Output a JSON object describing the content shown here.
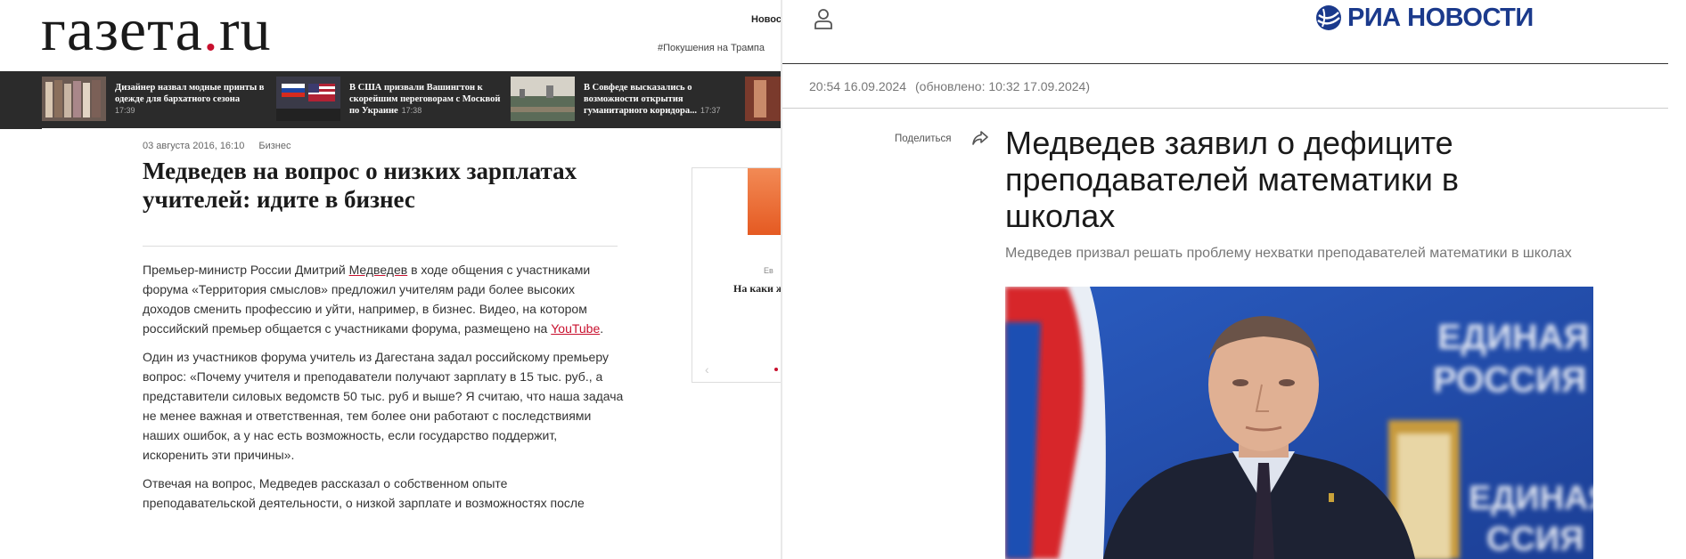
{
  "gazeta": {
    "logo": {
      "main": "газета",
      "dot": ".",
      "tld": "ru"
    },
    "nav_news": "Новос",
    "tag": "#Покушения на Трампа",
    "strip": [
      {
        "title": "Дизайнер назвал модные принты в одежде для бархатного сезона",
        "time": "17:39"
      },
      {
        "title": "В США призвали Вашингтон к скорейшим переговорам с Москвой по Украине",
        "time": "17:38"
      },
      {
        "title": "В Совфеде высказались о возможности открытия гуманитарного коридора...",
        "time": "17:37"
      }
    ],
    "article": {
      "date": "03 августа 2016, 16:10",
      "rubric": "Бизнес",
      "title": "Медведев на вопрос о низких зарплатах учителей: идите в бизнес",
      "p1_a": "Премьер-министр России Дмитрий ",
      "p1_link": "Медведев",
      "p1_b": " в ходе общения с участниками форума «Территория смыслов» предложил учителям ради более высоких доходов сменить профессию и уйти, например, в бизнес. Видео, на котором российский премьер общается с участниками форума, размещено на ",
      "p1_yt": "YouTube",
      "p1_end": ".",
      "p2": "Один из участников форума учитель из Дагестана задал российскому премьеру вопрос: «Почему учителя и преподаватели получают зарплату в 15 тыс. руб., а представители силовых ведомств 50 тыс. руб и выше? Я считаю, что наша задача не менее важная и ответственная, тем более они работают с последствиями наших ошибок, а у нас есть возможность, если государство поддержит, искоренить эти причины».",
      "p3": "Отвечая на вопрос, Медведев рассказал о собственном опыте преподавательской деятельности, о низкой зарплате и возможностях после"
    },
    "sidebar": {
      "category": "Ев",
      "title": "На каки жения"
    }
  },
  "ria": {
    "logo_text": "РИА НОВОСТИ",
    "date": "20:54 16.09.2024",
    "updated": "(обновлено: 10:32 17.09.2024)",
    "share": "Поделиться",
    "title": "Медведев заявил о дефиците преподавателей математики в школах",
    "subtitle": "Медведев призвал решать проблему нехватки преподавателей математики в школах",
    "photo_text_1": "ЕДИНАЯ",
    "photo_text_2": "РОССИЯ",
    "photo_text_3": "ЕДИНАЯ",
    "photo_text_4": "ССИЯ"
  },
  "colors": {
    "gazeta_red": "#c8102e",
    "ria_blue": "#1b3a8c",
    "strip_bg": "#2b2b2b"
  },
  "icons": [
    "user-icon",
    "share-icon",
    "ria-globe-icon",
    "arrow-left-icon"
  ]
}
